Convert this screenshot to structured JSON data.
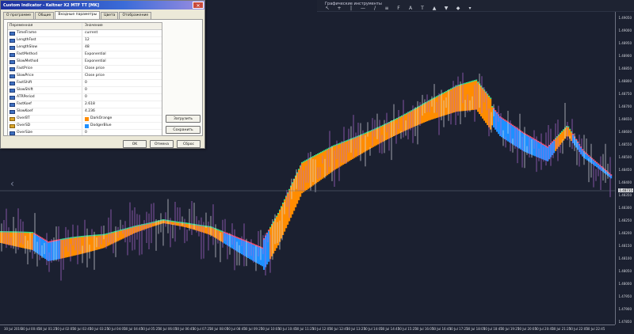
{
  "dialog": {
    "title": "Custom Indicator - Keltner X2 MTF TT [MK]",
    "tabs": [
      "О программе",
      "Общие",
      "Входные параметры",
      "Цвета",
      "Отображение"
    ],
    "active_tab": 2,
    "columns": {
      "name": "Переменная",
      "value": "Значение"
    },
    "params": [
      {
        "name": "TimeFrame",
        "value": "current",
        "icon": "param-icon"
      },
      {
        "name": "LengthFast",
        "value": "12",
        "icon": "param-icon"
      },
      {
        "name": "LengthSlow",
        "value": "48",
        "icon": "param-icon"
      },
      {
        "name": "FastMethod",
        "value": "Exponential",
        "icon": "param-icon"
      },
      {
        "name": "SlowMethod",
        "value": "Exponential",
        "icon": "param-icon"
      },
      {
        "name": "FastPrice",
        "value": "Close price",
        "icon": "param-icon"
      },
      {
        "name": "SlowPrice",
        "value": "Close price",
        "icon": "param-icon"
      },
      {
        "name": "FastShift",
        "value": "0",
        "icon": "param-icon"
      },
      {
        "name": "SlowShift",
        "value": "0",
        "icon": "param-icon"
      },
      {
        "name": "ATRPeriod",
        "value": "0",
        "icon": "param-icon"
      },
      {
        "name": "FastKoef",
        "value": "2.618",
        "icon": "param-icon"
      },
      {
        "name": "SlowKoef",
        "value": "4.236",
        "icon": "param-icon"
      },
      {
        "name": "OverBT",
        "value": "DarkOrange",
        "icon": "color-icon",
        "swatch": "#ff8c00"
      },
      {
        "name": "OverSD",
        "value": "DodgerBlue",
        "icon": "color-icon",
        "swatch": "#1e90ff"
      },
      {
        "name": "OverSize",
        "value": "0",
        "icon": "param-icon"
      }
    ],
    "buttons": {
      "load": "Загрузить",
      "save": "Сохранить",
      "ok": "OK",
      "cancel": "Отмена",
      "reset": "Сброс"
    }
  },
  "toolbar": {
    "title": "Графические инструменты",
    "icons": [
      "cursor-icon",
      "crosshair-icon",
      "vertical-line-icon",
      "horizontal-line-icon",
      "trendline-icon",
      "channel-icon",
      "fibonacci-icon",
      "text-icon",
      "label-icon",
      "arrow-up-icon",
      "arrow-down-icon",
      "shapes-icon",
      "more-icon"
    ]
  },
  "chart": {
    "price_labels": [
      "1.49050",
      "1.49000",
      "1.48950",
      "1.48900",
      "1.48850",
      "1.48800",
      "1.48750",
      "1.48700",
      "1.48650",
      "1.48600",
      "1.48550",
      "1.48500",
      "1.48450",
      "1.48400",
      "1.48350",
      "1.48300",
      "1.48250",
      "1.48200",
      "1.48150",
      "1.48100",
      "1.48050",
      "1.48000",
      "1.47950",
      "1.47900",
      "1.47850"
    ],
    "current_price": "1.48735",
    "time_labels": [
      "30 Jul 2019",
      "30 Jul 00:45",
      "30 Jul 01:25",
      "30 Jul 02:05",
      "30 Jul 02:45",
      "30 Jul 03:25",
      "30 Jul 04:05",
      "30 Jul 04:45",
      "30 Jul 05:25",
      "30 Jul 06:05",
      "30 Jul 06:45",
      "30 Jul 07:25",
      "30 Jul 08:05",
      "30 Jul 08:45",
      "30 Jul 09:25",
      "30 Jul 10:05",
      "30 Jul 10:45",
      "30 Jul 11:25",
      "30 Jul 12:05",
      "30 Jul 12:45",
      "30 Jul 13:25",
      "30 Jul 14:05",
      "30 Jul 14:45",
      "30 Jul 15:25",
      "30 Jul 16:05",
      "30 Jul 16:45",
      "30 Jul 17:25",
      "30 Jul 18:05",
      "30 Jul 18:45",
      "30 Jul 19:25",
      "30 Jul 20:05",
      "30 Jul 20:45",
      "30 Jul 21:25",
      "30 Jul 22:05",
      "30 Jul 22:45"
    ],
    "colors": {
      "background": "#1b2030",
      "bull_fill": "#ff8c00",
      "bear_fill": "#1e90ff",
      "bars": "#b06ad8",
      "edge_green": "#37d98a",
      "edge_red": "#ff4d6a"
    }
  }
}
